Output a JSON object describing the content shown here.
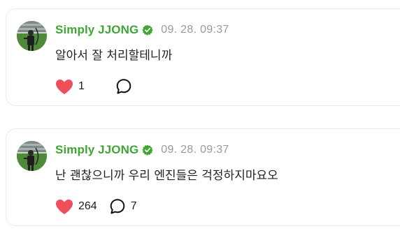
{
  "comments": [
    {
      "username": "Simply JJONG",
      "timestamp": "09. 28. 09:37",
      "text": "알아서 잘 처리할테니까",
      "likes": "1",
      "replies": ""
    },
    {
      "username": "Simply JJONG",
      "timestamp": "09. 28. 09:37",
      "text": "난 괜찮으니까 우리 엔진들은 걱정하지마요오",
      "likes": "264",
      "replies": "7"
    }
  ],
  "colors": {
    "username": "#3fa636",
    "verified_badge": "#3fa636",
    "heart": "#ef4f58",
    "timestamp": "#9a9a9a"
  },
  "icons": {
    "verified": "verified-check-icon",
    "like": "heart-icon",
    "reply": "speech-bubble-icon"
  }
}
